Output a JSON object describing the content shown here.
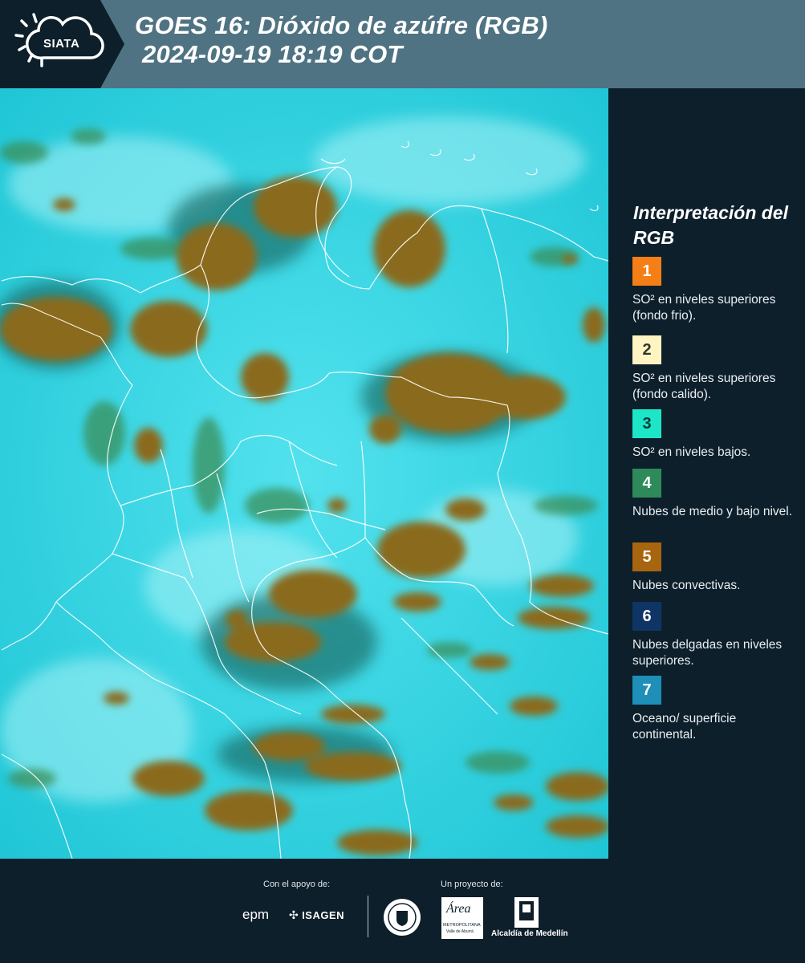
{
  "header": {
    "brand": "SIATA",
    "title_line1": "GOES 16: Dióxido de azúfre (RGB)",
    "title_line2": "2024-09-19 18:19 COT"
  },
  "legend": {
    "title": "Interpretación del RGB",
    "items": [
      {
        "number": "1",
        "color": "#f57f17",
        "text": "SO² en niveles superiores (fondo frio)."
      },
      {
        "number": "2",
        "color": "#fff4c2",
        "text": "SO² en niveles superiores (fondo calido)."
      },
      {
        "number": "3",
        "color": "#1de6c8",
        "text": "SO² en niveles bajos."
      },
      {
        "number": "4",
        "color": "#2e8a5a",
        "text": "Nubes de medio y bajo nivel."
      },
      {
        "number": "5",
        "color": "#a8650f",
        "text": "Nubes convectivas."
      },
      {
        "number": "6",
        "color": "#0f3566",
        "text": "Nubes delgadas en niveles superiores."
      },
      {
        "number": "7",
        "color": "#1d8fb8",
        "text": "Oceano/ superficie continental."
      }
    ]
  },
  "footer": {
    "support_label": "Con el apoyo de:",
    "project_label": "Un proyecto de:",
    "sponsor1": "epm",
    "sponsor2": "ISAGEN",
    "partner_area_line1": "Área",
    "partner_area_line2": "METROPOLITANA",
    "partner_area_line3": "Valle de Aburrá",
    "partner_city": "Alcaldía de Medellín",
    "seal_text": "MEDELLÍN"
  },
  "colors": {
    "header_bg": "#4f7382",
    "panel_bg": "#0d1f2b",
    "map_background": "#2fd3e0",
    "convective_cloud": "#8a6a1e",
    "mid_low_cloud": "#3a8f5a"
  }
}
